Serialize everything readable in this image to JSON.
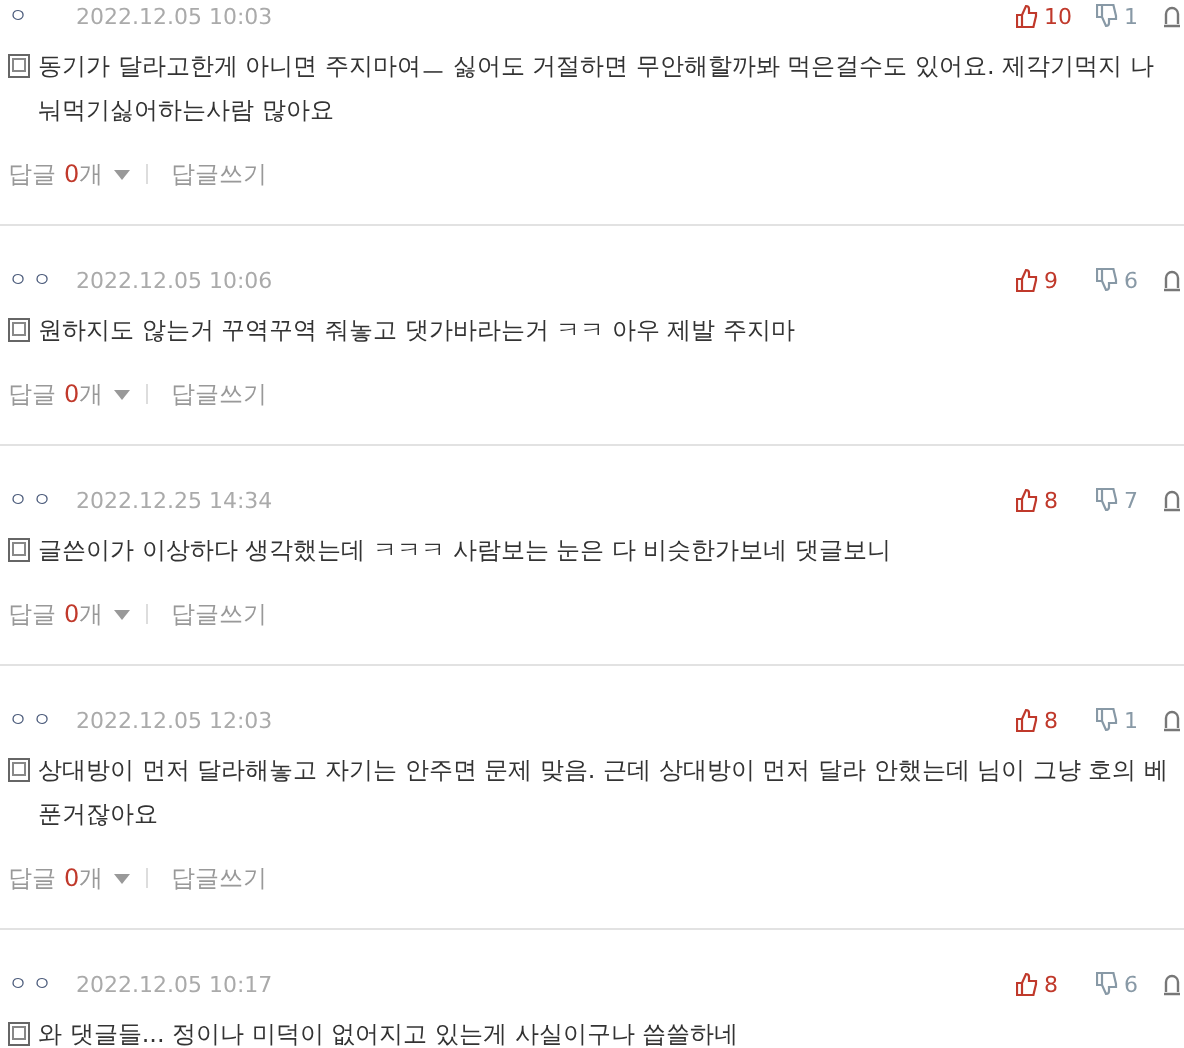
{
  "comments": [
    {
      "author": "ㅇ",
      "date": "2022.12.05 10:03",
      "text": "동기가 달라고한게 아니면 주지마여ㅡ 싫어도 거절하면 무안해할까봐 먹은걸수도 있어요. 제각기먹지 나눠먹기싫어하는사람 많아요",
      "likes": "10",
      "dislikes": "1",
      "reply": {
        "label": "답글",
        "count": "0",
        "unit": "개",
        "write": "답글쓰기"
      }
    },
    {
      "author": "ㅇㅇ",
      "date": "2022.12.05 10:06",
      "text": "원하지도 않는거 꾸역꾸역 줘놓고 댓가바라는거 ㅋㅋ 아우 제발 주지마",
      "likes": "9",
      "dislikes": "6",
      "reply": {
        "label": "답글",
        "count": "0",
        "unit": "개",
        "write": "답글쓰기"
      }
    },
    {
      "author": "ㅇㅇ",
      "date": "2022.12.25 14:34",
      "text": "글쓴이가 이상하다 생각했는데 ㅋㅋㅋ 사람보는 눈은 다 비슷한가보네 댓글보니",
      "likes": "8",
      "dislikes": "7",
      "reply": {
        "label": "답글",
        "count": "0",
        "unit": "개",
        "write": "답글쓰기"
      }
    },
    {
      "author": "ㅇㅇ",
      "date": "2022.12.05 12:03",
      "text": "상대방이 먼저 달라해놓고 자기는 안주면 문제 맞음. 근데 상대방이 먼저 달라 안했는데 님이 그냥 호의 베푼거잖아요",
      "likes": "8",
      "dislikes": "1",
      "reply": {
        "label": "답글",
        "count": "0",
        "unit": "개",
        "write": "답글쓰기"
      }
    },
    {
      "author": "ㅇㅇ",
      "date": "2022.12.05 10:17",
      "text": "와 댓글들... 정이나 미덕이 없어지고 있는게 사실이구나 씁쓸하네",
      "likes": "8",
      "dislikes": "6"
    }
  ]
}
